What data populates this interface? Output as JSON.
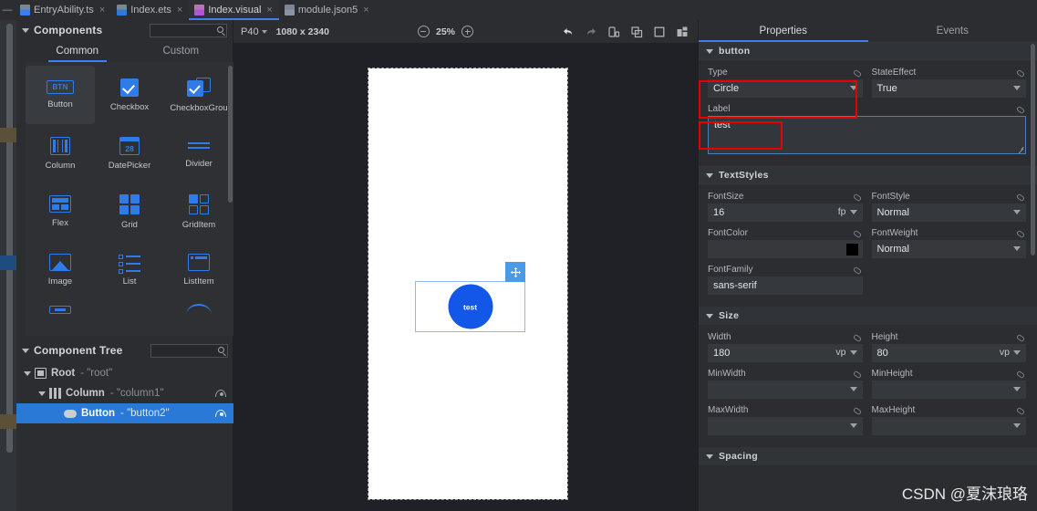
{
  "tabs": [
    {
      "label": "EntryAbility.ts",
      "icon": "typescript-file-icon",
      "kind": "ts",
      "active": false
    },
    {
      "label": "Index.ets",
      "icon": "ets-file-icon",
      "kind": "ets",
      "active": false
    },
    {
      "label": "Index.visual",
      "icon": "visual-file-icon",
      "kind": "visual",
      "active": true
    },
    {
      "label": "module.json5",
      "icon": "json-file-icon",
      "kind": "json",
      "active": false
    }
  ],
  "close_glyph": "×",
  "components_panel": {
    "title": "Components",
    "search_placeholder": "",
    "search_value": "",
    "tabs": [
      {
        "label": "Common",
        "active": true
      },
      {
        "label": "Custom",
        "active": false
      }
    ],
    "items": [
      {
        "label": "Button",
        "icon": "button-icon",
        "shape": "btn",
        "hover": true
      },
      {
        "label": "Checkbox",
        "icon": "checkbox-icon",
        "shape": "check",
        "hover": false
      },
      {
        "label": "CheckboxGrou",
        "icon": "checkbox-group-icon",
        "shape": "checkgrp",
        "hover": false
      },
      {
        "label": "Column",
        "icon": "column-icon",
        "shape": "column",
        "hover": false
      },
      {
        "label": "DatePicker",
        "icon": "datepicker-icon",
        "shape": "date",
        "hover": false
      },
      {
        "label": "Divider",
        "icon": "divider-icon",
        "shape": "divider",
        "hover": false
      },
      {
        "label": "Flex",
        "icon": "flex-icon",
        "shape": "flex",
        "hover": false
      },
      {
        "label": "Grid",
        "icon": "grid-icon",
        "shape": "grid",
        "hover": false
      },
      {
        "label": "GridItem",
        "icon": "griditem-icon",
        "shape": "griditem",
        "hover": false
      },
      {
        "label": "Image",
        "icon": "image-icon",
        "shape": "image",
        "hover": false
      },
      {
        "label": "List",
        "icon": "list-icon",
        "shape": "list",
        "hover": false
      },
      {
        "label": "ListItem",
        "icon": "listitem-icon",
        "shape": "listitem",
        "hover": false
      }
    ],
    "date_day": "28",
    "button_glyph": "BTN"
  },
  "component_tree": {
    "title": "Component Tree",
    "search_value": "",
    "rows": [
      {
        "name": "Root",
        "id": "- \"root\"",
        "icon": "root-icon",
        "shape": "root",
        "indent": 8,
        "expanded": true,
        "selected": false,
        "eye": false
      },
      {
        "name": "Column",
        "id": "- \"column1\"",
        "icon": "column-icon",
        "shape": "col",
        "indent": 24,
        "expanded": true,
        "selected": false,
        "eye": true
      },
      {
        "name": "Button",
        "id": "- \"button2\"",
        "icon": "button-icon",
        "shape": "btn",
        "indent": 48,
        "expanded": false,
        "selected": true,
        "eye": true
      }
    ]
  },
  "canvas": {
    "device": "P40",
    "resolution": "1080 x 2340",
    "zoom": "25%",
    "toolbar_icons": [
      {
        "name": "undo-icon",
        "active": true
      },
      {
        "name": "redo-icon",
        "active": false
      },
      {
        "name": "device-preview-icon",
        "active": false
      },
      {
        "name": "multi-select-icon",
        "active": false
      },
      {
        "name": "fullscreen-icon",
        "active": false
      },
      {
        "name": "split-layout-icon",
        "active": false
      }
    ],
    "selected_button_label": "test",
    "move_handle_glyph": "✥"
  },
  "properties": {
    "tabs": [
      {
        "label": "Properties",
        "active": true
      },
      {
        "label": "Events",
        "active": false
      }
    ],
    "sections": [
      {
        "title": "button",
        "fields": [
          {
            "label": "Type",
            "value": "Circle",
            "control": "select",
            "highlight": true
          },
          {
            "label": "StateEffect",
            "value": "True",
            "control": "select",
            "highlight": false
          },
          {
            "label": "Label",
            "value": "test",
            "control": "textarea",
            "highlight": true,
            "full": true
          }
        ]
      },
      {
        "title": "TextStyles",
        "fields": [
          {
            "label": "FontSize",
            "value": "16",
            "control": "unit-select",
            "unit": "fp"
          },
          {
            "label": "FontStyle",
            "value": "Normal",
            "control": "select"
          },
          {
            "label": "FontColor",
            "value": "",
            "control": "color",
            "color": "#000000"
          },
          {
            "label": "FontWeight",
            "value": "Normal",
            "control": "select"
          },
          {
            "label": "FontFamily",
            "value": "sans-serif",
            "control": "text"
          }
        ]
      },
      {
        "title": "Size",
        "fields": [
          {
            "label": "Width",
            "value": "180",
            "control": "unit-select",
            "unit": "vp"
          },
          {
            "label": "Height",
            "value": "80",
            "control": "unit-select",
            "unit": "vp"
          },
          {
            "label": "MinWidth",
            "value": "",
            "control": "select"
          },
          {
            "label": "MinHeight",
            "value": "",
            "control": "select"
          },
          {
            "label": "MaxWidth",
            "value": "",
            "control": "select"
          },
          {
            "label": "MaxHeight",
            "value": "",
            "control": "select"
          }
        ]
      },
      {
        "title": "Spacing",
        "fields": []
      }
    ]
  },
  "watermark": "CSDN @夏沫琅珞",
  "colors": {
    "accent_blue": "#3c7ff0",
    "selection_blue": "#2a79d6",
    "icon_blue": "#2f7ce8",
    "button_blue": "#1257e8",
    "highlight_red": "#e60000",
    "panel_bg": "#2b2d30",
    "canvas_bg": "#1f2126"
  }
}
